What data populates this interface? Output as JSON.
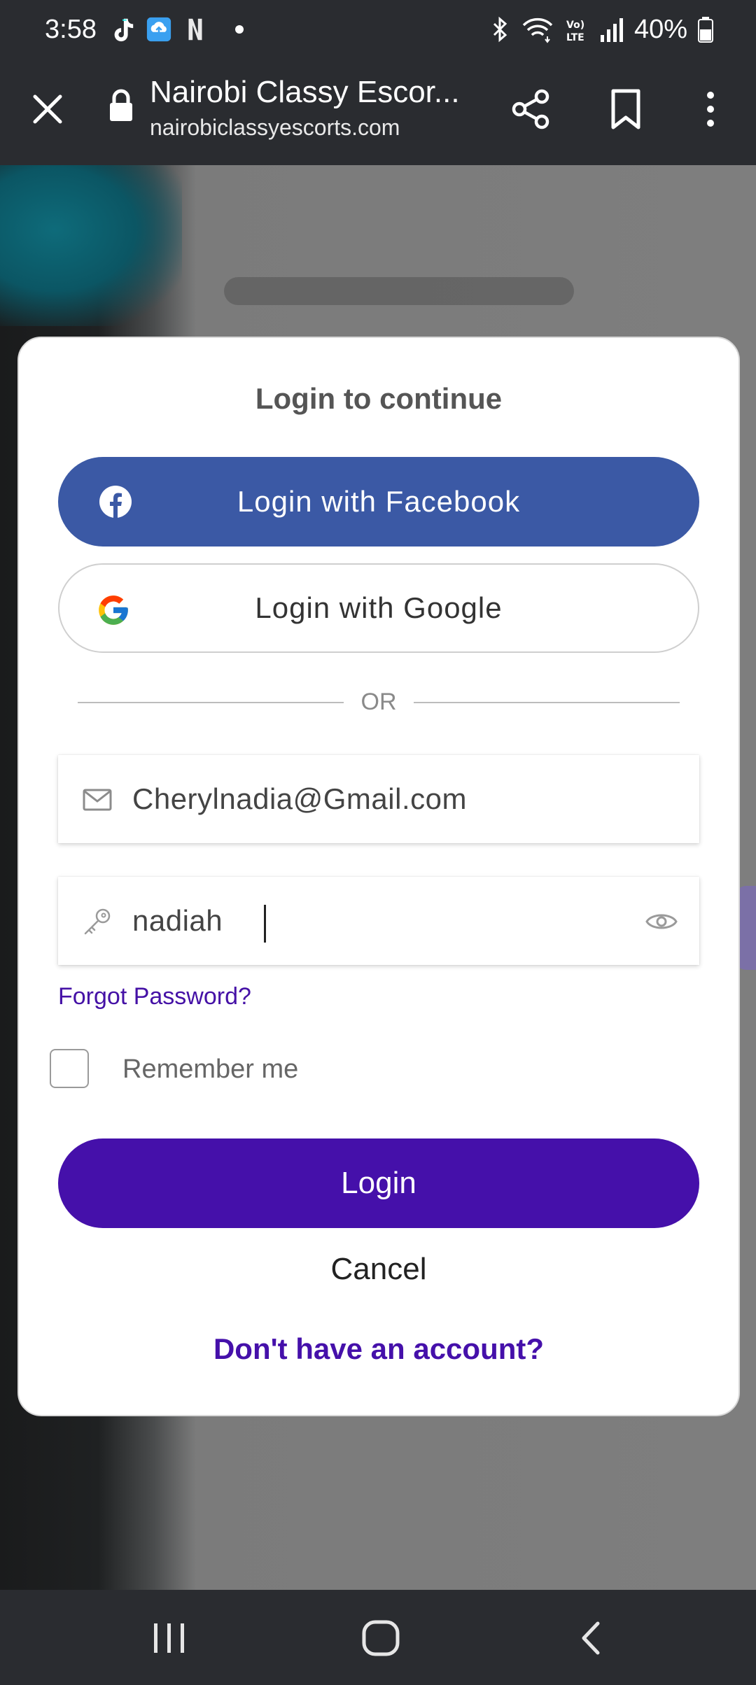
{
  "status_bar": {
    "time": "3:58",
    "battery": "40%",
    "icons": [
      "tiktok-icon",
      "cloud-upload-icon",
      "netflix-icon",
      "notification-dot",
      "bluetooth-icon",
      "wifi-icon",
      "volte-icon",
      "signal-icon",
      "battery-icon"
    ]
  },
  "browser": {
    "page_title": "Nairobi Classy Escor...",
    "url": "nairobiclassyescorts.com"
  },
  "login_modal": {
    "title": "Login to continue",
    "facebook_button": "Login with Facebook",
    "google_button": "Login with Google",
    "divider_text": "OR",
    "email": {
      "value": "Cherylnadia@Gmail.com"
    },
    "password": {
      "value": "nadiah"
    },
    "forgot_password": "Forgot Password?",
    "remember_me": {
      "label": "Remember me",
      "checked": false
    },
    "login_button": "Login",
    "cancel_button": "Cancel",
    "signup_link": "Don't have an account?"
  },
  "colors": {
    "facebook_blue": "#3b59a5",
    "primary_purple": "#4510aa",
    "link_purple": "#4511a6",
    "system_bar": "#2a2c30"
  }
}
